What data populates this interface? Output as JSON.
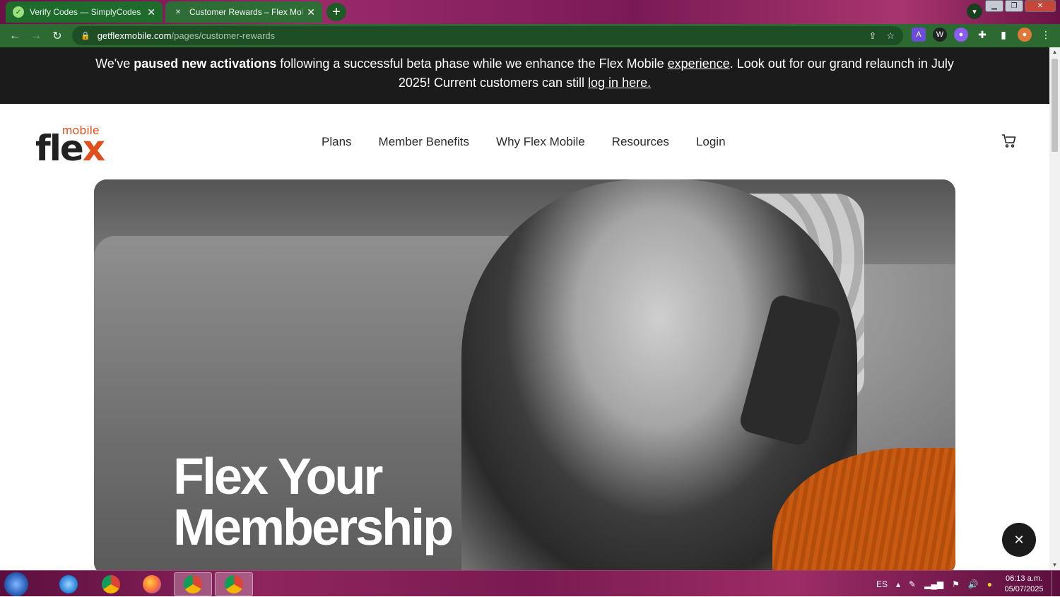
{
  "browser": {
    "tabs": [
      {
        "title": "Verify Codes — SimplyCodes",
        "close": "✕"
      },
      {
        "title": "Customer Rewards – Flex Mobile",
        "close": "✕"
      }
    ],
    "new_tab": "+",
    "url_host": "getflexmobile.com",
    "url_path": "/pages/customer-rewards"
  },
  "announcement": {
    "prefix": "We've ",
    "bold": "paused new activations",
    "middle": " following a successful beta phase while we enhance the Flex Mobile ",
    "link1": "experience",
    "after_link1": ". Look out for our grand relaunch in July 2025! Current customers can still ",
    "link2": "log in here."
  },
  "header": {
    "logo_top": "mobile",
    "logo_main": "fle",
    "logo_x": "x",
    "nav": [
      "Plans",
      "Member Benefits",
      "Why Flex Mobile",
      "Resources",
      "Login"
    ]
  },
  "hero": {
    "line1": "Flex Your",
    "line2": "Membership"
  },
  "chat_close": "✕",
  "taskbar": {
    "language": "ES",
    "time": "06:13 a.m.",
    "date": "05/07/2025"
  },
  "colors": {
    "brand_orange": "#e04e1c",
    "chrome_green": "#2c6a32",
    "announcement_bg": "#1b1b1b"
  }
}
